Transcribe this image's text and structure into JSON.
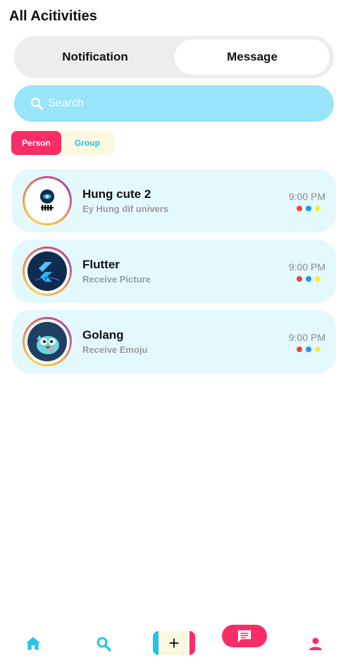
{
  "header": {
    "title": "All Acitivities"
  },
  "segments": {
    "left": "Notification",
    "right": "Message",
    "selected": "Message"
  },
  "search": {
    "placeholder": "Search"
  },
  "filters": {
    "person": "Person",
    "group": "Group",
    "selected": "Person"
  },
  "conversations": [
    {
      "name": "Hung cute 2",
      "preview": "Ey Hung dif univers",
      "time": "9:00 PM",
      "avatar": "hung-avatar"
    },
    {
      "name": "Flutter",
      "preview": "Receive Picture",
      "time": "9:00 PM",
      "avatar": "flutter-logo"
    },
    {
      "name": "Golang",
      "preview": "Receive Emoju",
      "time": "9:00 PM",
      "avatar": "gopher-logo"
    }
  ],
  "dot_colors": [
    "#f44336",
    "#2196f3",
    "#ffeb3b"
  ],
  "bottom_nav": [
    "home-icon",
    "search-icon",
    "add-icon",
    "chat-icon",
    "person-icon"
  ],
  "colors": {
    "accent_pink": "#fb2c68",
    "accent_cyan": "#22c6e3",
    "search_bg": "#98e5fb",
    "card_bg": "#e4f9fd"
  }
}
